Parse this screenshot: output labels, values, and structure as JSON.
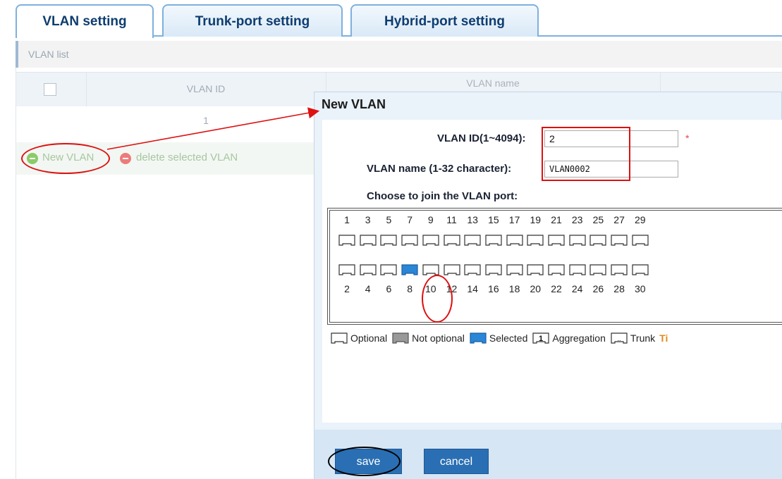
{
  "tabs": [
    {
      "label": "VLAN setting",
      "active": true
    },
    {
      "label": "Trunk-port setting",
      "active": false
    },
    {
      "label": "Hybrid-port setting",
      "active": false
    }
  ],
  "vlan_list": {
    "title": "VLAN list",
    "columns": [
      "VLAN ID",
      "VLAN name"
    ],
    "rows": [
      {
        "id": "1"
      }
    ],
    "actions": {
      "new_vlan": "New VLAN",
      "delete_selected": "delete selected VLAN"
    }
  },
  "dialog": {
    "title": "New VLAN",
    "vlan_id_label": "VLAN ID(1~4094):",
    "vlan_id_value": "2",
    "required_mark": "*",
    "vlan_name_label": "VLAN name (1-32 character):",
    "vlan_name_value": "VLAN0002",
    "choose_label": "Choose to join the VLAN port:",
    "ports_top": [
      "1",
      "3",
      "5",
      "7",
      "9",
      "11",
      "13",
      "15",
      "17",
      "19",
      "21",
      "23",
      "25",
      "27",
      "29"
    ],
    "ports_bottom": [
      "2",
      "4",
      "6",
      "8",
      "10",
      "12",
      "14",
      "16",
      "18",
      "20",
      "22",
      "24",
      "26",
      "28",
      "30"
    ],
    "selected_port": "8",
    "legend": {
      "optional": "Optional",
      "not_optional": "Not optional",
      "selected": "Selected",
      "aggregation": "Aggregation",
      "aggregation_glyph": "1",
      "trunk": "Trunk",
      "tip": "Ti"
    },
    "save_label": "save",
    "cancel_label": "cancel"
  },
  "colors": {
    "tab_text": "#0e3d70",
    "port_selected": "#2a86d6",
    "button_bg": "#2a6fb3",
    "annotation_red": "#dd1111"
  }
}
